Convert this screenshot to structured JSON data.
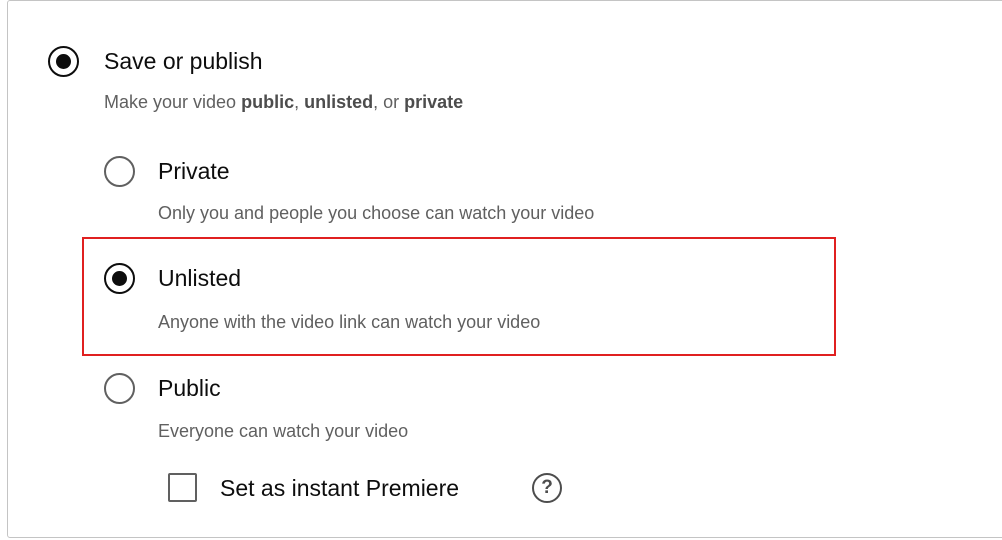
{
  "save_or_publish": {
    "title": "Save or publish",
    "desc_prefix": "Make your video ",
    "desc_public": "public",
    "desc_sep1": ", ",
    "desc_unlisted": "unlisted",
    "desc_sep2": ", or ",
    "desc_private": "private",
    "selected": true
  },
  "visibility_options": [
    {
      "label": "Private",
      "description": "Only you and people you choose can watch your video",
      "selected": false
    },
    {
      "label": "Unlisted",
      "description": "Anyone with the video link can watch your video",
      "selected": true
    },
    {
      "label": "Public",
      "description": "Everyone can watch your video",
      "selected": false
    }
  ],
  "premiere": {
    "label": "Set as instant Premiere",
    "checked": false,
    "help_glyph": "?"
  },
  "colors": {
    "highlight": "#e02020",
    "text_primary": "#0d0d0d",
    "text_secondary": "#606060"
  },
  "icons": {
    "help": "help-circle-icon"
  }
}
